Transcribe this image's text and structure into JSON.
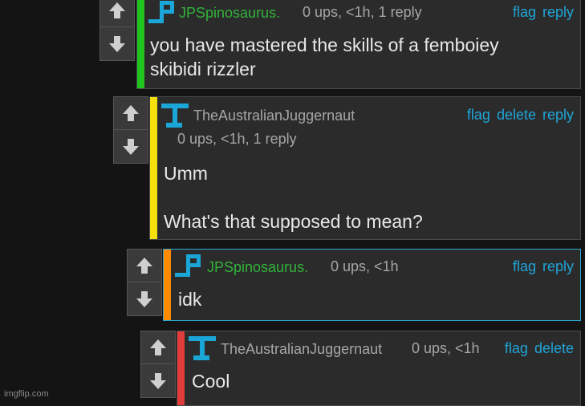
{
  "comments": [
    {
      "username": "JPSpinosaurus.",
      "meta": "0 ups, <1h, 1 reply",
      "actions": [
        "flag",
        "reply"
      ],
      "text": [
        "you have mastered the skills of a femboiey",
        "skibidi rizzler"
      ],
      "bar_color": "#22c41f",
      "avatar": "P-icon"
    },
    {
      "username": "TheAustralianJuggernaut",
      "meta": "0 ups, <1h, 1 reply",
      "actions": [
        "flag",
        "delete",
        "reply"
      ],
      "text": [
        "Umm",
        "",
        "What's that supposed to mean?"
      ],
      "bar_color": "#f4e10c",
      "avatar": "T-icon"
    },
    {
      "username": "JPSpinosaurus.",
      "meta": "0 ups, <1h",
      "actions": [
        "flag",
        "reply"
      ],
      "text": [
        "idk"
      ],
      "bar_color": "#ff8a00",
      "avatar": "P-icon"
    },
    {
      "username": "TheAustralianJuggernaut",
      "meta": "0 ups, <1h",
      "actions": [
        "flag",
        "delete"
      ],
      "text": [
        "Cool"
      ],
      "bar_color": "#e03b3b",
      "avatar": "T-icon"
    }
  ],
  "watermark": "imgflip.com",
  "colors": {
    "background": "#141414",
    "panel": "#2b2b2b",
    "link": "#1fa5d8",
    "username_green": "#32b33a",
    "avatar_blue": "#1aa7d8"
  }
}
